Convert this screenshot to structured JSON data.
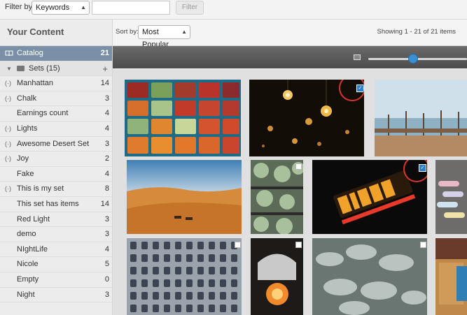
{
  "filter": {
    "label": "Filter by",
    "field_value": "Keywords",
    "search_value": "",
    "button_label": "Filter"
  },
  "sidebar": {
    "title": "Your Content",
    "catalog": {
      "label": "Catalog",
      "count": "21"
    },
    "sets_header": {
      "label": "Sets (15)"
    },
    "items": [
      {
        "label": "Manhattan",
        "count": "14",
        "smart": true
      },
      {
        "label": "Chalk",
        "count": "3",
        "smart": true
      },
      {
        "label": "Earnings count",
        "count": "4",
        "smart": false
      },
      {
        "label": "Lights",
        "count": "4",
        "smart": true
      },
      {
        "label": "Awesome Desert Set",
        "count": "3",
        "smart": true
      },
      {
        "label": "Joy",
        "count": "2",
        "smart": true
      },
      {
        "label": "Fake",
        "count": "4",
        "smart": false
      },
      {
        "label": "This is my set",
        "count": "8",
        "smart": true
      },
      {
        "label": "This set has items",
        "count": "14",
        "smart": false
      },
      {
        "label": "Red Light",
        "count": "3",
        "smart": false
      },
      {
        "label": "demo",
        "count": "3",
        "smart": false
      },
      {
        "label": "NIghtLife",
        "count": "4",
        "smart": false
      },
      {
        "label": "Nicole",
        "count": "5",
        "smart": false
      },
      {
        "label": "Empty",
        "count": "0",
        "smart": false
      },
      {
        "label": "Night",
        "count": "3",
        "smart": false
      }
    ]
  },
  "content": {
    "sort_label": "Sort by:",
    "sort_value": "Most Popular",
    "showing": "Showing 1 - 21 of 21 items",
    "zoom_level": 0.45
  },
  "icons": {
    "catalog": "book-icon",
    "smart_set": "broadcast-icon",
    "folder": "folder-icon",
    "add": "plus-icon",
    "image_size": "image-icon"
  },
  "colors": {
    "selection_highlight": "#d7342b",
    "checkbox_checked": "#2b7fd0",
    "catalog_row": "#7a8fa8",
    "slider_knob": "#3a8fd1"
  },
  "photos": [
    {
      "subject": "vegetable market crates",
      "checked": false
    },
    {
      "subject": "hanging light bulbs",
      "checked": true
    },
    {
      "subject": "pier fishing rods",
      "checked": false
    },
    {
      "subject": "desert camels",
      "checked": false
    },
    {
      "subject": "succulent plants",
      "checked": false
    },
    {
      "subject": "neon diner sign",
      "checked": true
    },
    {
      "subject": "chalk",
      "checked": false
    },
    {
      "subject": "building windows",
      "checked": false
    },
    {
      "subject": "red light",
      "checked": false
    },
    {
      "subject": "cactus",
      "checked": false
    },
    {
      "subject": "bags",
      "checked": false
    }
  ]
}
